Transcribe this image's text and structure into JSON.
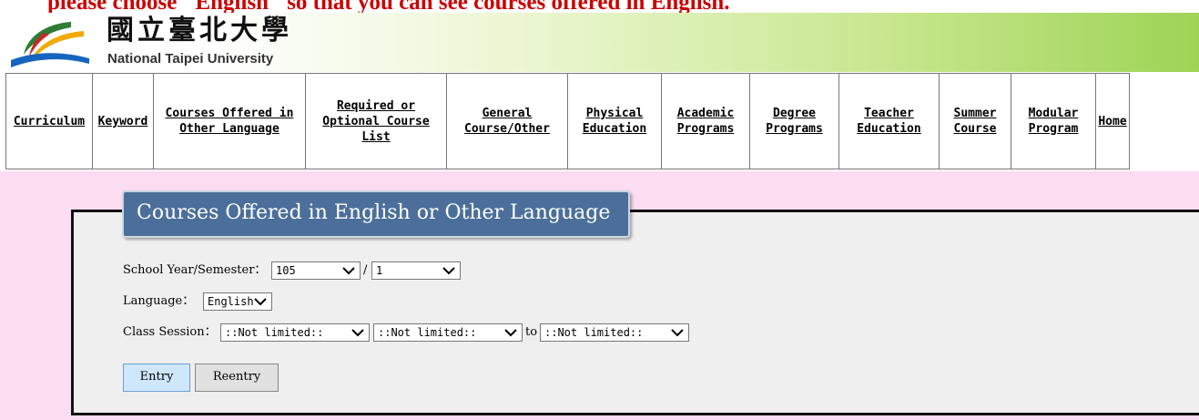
{
  "instruction": "please choose \"English\" so that you can see courses offered in English.",
  "header": {
    "university_zh": "國立臺北大學",
    "university_en": "National Taipei University",
    "logo_icon": "ntpu-logo-icon"
  },
  "nav": [
    {
      "label": "Curriculum",
      "lines": [
        "Curriculum"
      ]
    },
    {
      "label": "Keyword",
      "lines": [
        "Keyword"
      ]
    },
    {
      "label": "Courses Offered in Other Language",
      "lines": [
        "Courses Offered in",
        "Other Language"
      ]
    },
    {
      "label": "Required or Optional Course List",
      "lines": [
        "Required or",
        "Optional Course",
        "List"
      ]
    },
    {
      "label": "General Course/Other",
      "lines": [
        "General",
        "Course/Other"
      ]
    },
    {
      "label": "Physical Education",
      "lines": [
        "Physical",
        "Education"
      ]
    },
    {
      "label": "Academic Programs",
      "lines": [
        "Academic",
        "Programs"
      ]
    },
    {
      "label": "Degree Programs",
      "lines": [
        "Degree",
        "Programs"
      ]
    },
    {
      "label": "Teacher Education",
      "lines": [
        "Teacher",
        "Education"
      ]
    },
    {
      "label": "Summer Course",
      "lines": [
        "Summer",
        "Course"
      ]
    },
    {
      "label": "Modular Program",
      "lines": [
        "Modular",
        "Program"
      ]
    },
    {
      "label": "Home",
      "lines": [
        "Home"
      ]
    }
  ],
  "panel": {
    "title": "Courses Offered in English or Other Language",
    "school_year_label": "School Year/Semester：",
    "school_year_value": "105",
    "separator": "/",
    "semester_value": "1",
    "language_label": "Language：",
    "language_value": "English",
    "class_session_label": "Class Session：",
    "session_value_1": "::Not limited::",
    "session_value_2": "::Not limited::",
    "to_label": "to",
    "session_value_3": "::Not limited::",
    "entry_button": "Entry",
    "reentry_button": "Reentry"
  },
  "colors": {
    "instruction": "#cc0000",
    "title_bg": "#4b6f9a",
    "pink_bg": "#fcdcf0",
    "panel_bg": "#efefef",
    "entry_bg": "#cfe7fb"
  }
}
